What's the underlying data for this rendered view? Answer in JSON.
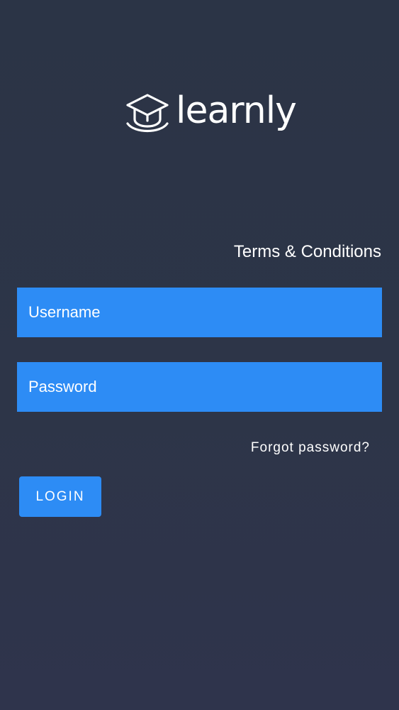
{
  "branding": {
    "logo_icon": "graduation-cap-icon",
    "name": "learnly"
  },
  "links": {
    "terms": "Terms & Conditions",
    "forgot_password": "Forgot password?"
  },
  "form": {
    "username_placeholder": "Username",
    "password_placeholder": "Password",
    "login_label": "LOGIN"
  },
  "colors": {
    "background": "#2c3547",
    "accent": "#2d8cf5",
    "text": "#ffffff"
  }
}
